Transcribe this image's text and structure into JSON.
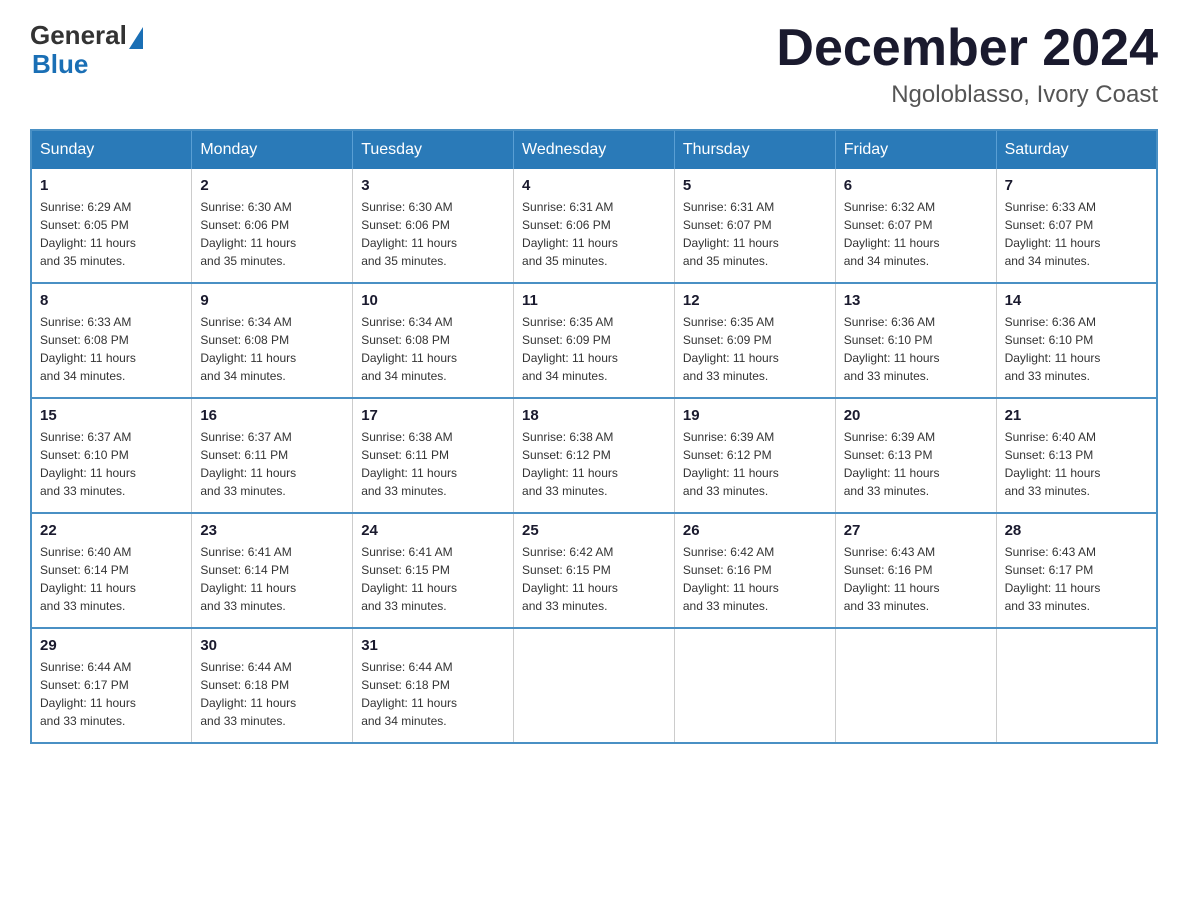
{
  "header": {
    "logo": {
      "general": "General",
      "blue": "Blue"
    },
    "month_title": "December 2024",
    "location": "Ngoloblasso, Ivory Coast"
  },
  "weekdays": [
    "Sunday",
    "Monday",
    "Tuesday",
    "Wednesday",
    "Thursday",
    "Friday",
    "Saturday"
  ],
  "weeks": [
    [
      {
        "day": "1",
        "sunrise": "6:29 AM",
        "sunset": "6:05 PM",
        "daylight": "11 hours and 35 minutes."
      },
      {
        "day": "2",
        "sunrise": "6:30 AM",
        "sunset": "6:06 PM",
        "daylight": "11 hours and 35 minutes."
      },
      {
        "day": "3",
        "sunrise": "6:30 AM",
        "sunset": "6:06 PM",
        "daylight": "11 hours and 35 minutes."
      },
      {
        "day": "4",
        "sunrise": "6:31 AM",
        "sunset": "6:06 PM",
        "daylight": "11 hours and 35 minutes."
      },
      {
        "day": "5",
        "sunrise": "6:31 AM",
        "sunset": "6:07 PM",
        "daylight": "11 hours and 35 minutes."
      },
      {
        "day": "6",
        "sunrise": "6:32 AM",
        "sunset": "6:07 PM",
        "daylight": "11 hours and 34 minutes."
      },
      {
        "day": "7",
        "sunrise": "6:33 AM",
        "sunset": "6:07 PM",
        "daylight": "11 hours and 34 minutes."
      }
    ],
    [
      {
        "day": "8",
        "sunrise": "6:33 AM",
        "sunset": "6:08 PM",
        "daylight": "11 hours and 34 minutes."
      },
      {
        "day": "9",
        "sunrise": "6:34 AM",
        "sunset": "6:08 PM",
        "daylight": "11 hours and 34 minutes."
      },
      {
        "day": "10",
        "sunrise": "6:34 AM",
        "sunset": "6:08 PM",
        "daylight": "11 hours and 34 minutes."
      },
      {
        "day": "11",
        "sunrise": "6:35 AM",
        "sunset": "6:09 PM",
        "daylight": "11 hours and 34 minutes."
      },
      {
        "day": "12",
        "sunrise": "6:35 AM",
        "sunset": "6:09 PM",
        "daylight": "11 hours and 33 minutes."
      },
      {
        "day": "13",
        "sunrise": "6:36 AM",
        "sunset": "6:10 PM",
        "daylight": "11 hours and 33 minutes."
      },
      {
        "day": "14",
        "sunrise": "6:36 AM",
        "sunset": "6:10 PM",
        "daylight": "11 hours and 33 minutes."
      }
    ],
    [
      {
        "day": "15",
        "sunrise": "6:37 AM",
        "sunset": "6:10 PM",
        "daylight": "11 hours and 33 minutes."
      },
      {
        "day": "16",
        "sunrise": "6:37 AM",
        "sunset": "6:11 PM",
        "daylight": "11 hours and 33 minutes."
      },
      {
        "day": "17",
        "sunrise": "6:38 AM",
        "sunset": "6:11 PM",
        "daylight": "11 hours and 33 minutes."
      },
      {
        "day": "18",
        "sunrise": "6:38 AM",
        "sunset": "6:12 PM",
        "daylight": "11 hours and 33 minutes."
      },
      {
        "day": "19",
        "sunrise": "6:39 AM",
        "sunset": "6:12 PM",
        "daylight": "11 hours and 33 minutes."
      },
      {
        "day": "20",
        "sunrise": "6:39 AM",
        "sunset": "6:13 PM",
        "daylight": "11 hours and 33 minutes."
      },
      {
        "day": "21",
        "sunrise": "6:40 AM",
        "sunset": "6:13 PM",
        "daylight": "11 hours and 33 minutes."
      }
    ],
    [
      {
        "day": "22",
        "sunrise": "6:40 AM",
        "sunset": "6:14 PM",
        "daylight": "11 hours and 33 minutes."
      },
      {
        "day": "23",
        "sunrise": "6:41 AM",
        "sunset": "6:14 PM",
        "daylight": "11 hours and 33 minutes."
      },
      {
        "day": "24",
        "sunrise": "6:41 AM",
        "sunset": "6:15 PM",
        "daylight": "11 hours and 33 minutes."
      },
      {
        "day": "25",
        "sunrise": "6:42 AM",
        "sunset": "6:15 PM",
        "daylight": "11 hours and 33 minutes."
      },
      {
        "day": "26",
        "sunrise": "6:42 AM",
        "sunset": "6:16 PM",
        "daylight": "11 hours and 33 minutes."
      },
      {
        "day": "27",
        "sunrise": "6:43 AM",
        "sunset": "6:16 PM",
        "daylight": "11 hours and 33 minutes."
      },
      {
        "day": "28",
        "sunrise": "6:43 AM",
        "sunset": "6:17 PM",
        "daylight": "11 hours and 33 minutes."
      }
    ],
    [
      {
        "day": "29",
        "sunrise": "6:44 AM",
        "sunset": "6:17 PM",
        "daylight": "11 hours and 33 minutes."
      },
      {
        "day": "30",
        "sunrise": "6:44 AM",
        "sunset": "6:18 PM",
        "daylight": "11 hours and 33 minutes."
      },
      {
        "day": "31",
        "sunrise": "6:44 AM",
        "sunset": "6:18 PM",
        "daylight": "11 hours and 34 minutes."
      },
      null,
      null,
      null,
      null
    ]
  ],
  "labels": {
    "sunrise": "Sunrise:",
    "sunset": "Sunset:",
    "daylight": "Daylight:"
  }
}
